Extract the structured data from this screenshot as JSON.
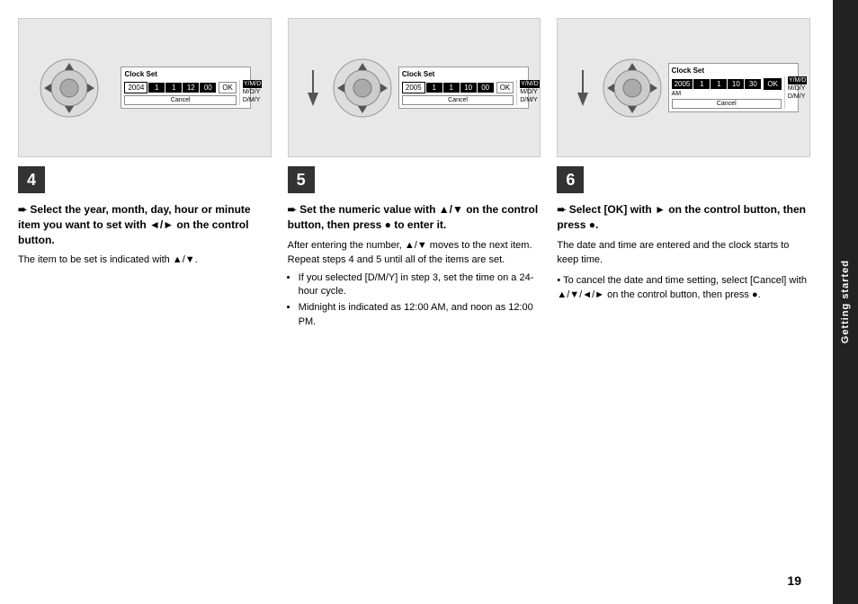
{
  "sidebar": {
    "label": "Getting started"
  },
  "page_number": "19",
  "steps": [
    {
      "number": "4",
      "heading": "Select the year, month, day, hour or minute item you want to set with ◄/► on the control button.",
      "body_text": "The item to be set is indicated with ▲/▼.",
      "clock_year": "2004",
      "clock_m1": "1",
      "clock_m2": "1",
      "clock_h": "12",
      "clock_min": "00",
      "clock_am": "",
      "active_field": "year"
    },
    {
      "number": "5",
      "heading": "Set the numeric value with ▲/▼ on the control button, then press ● to enter it.",
      "body_text": "After entering the number, ▲/▼ moves to the next item. Repeat steps 4 and 5 until all of the items are set.",
      "bullets": [
        "If you selected [D/M/Y] in step 3, set the time on a 24-hour cycle.",
        "Midnight is indicated as 12:00 AM, and noon as 12:00 PM."
      ],
      "clock_year": "2005",
      "clock_m1": "1",
      "clock_m2": "1",
      "clock_h": "10",
      "clock_min": "00",
      "clock_am": "",
      "active_field": "year"
    },
    {
      "number": "6",
      "heading": "Select [OK] with ► on the control button, then press ●.",
      "body_text": "The date and time are entered and the clock starts to keep time.",
      "bullet": "To cancel the date and time setting, select [Cancel] with ▲/▼/◄/► on the control button, then press ●.",
      "clock_year": "2005",
      "clock_m1": "1",
      "clock_m2": "1",
      "clock_h": "10",
      "clock_min": "30",
      "clock_am": "AM",
      "active_field": "ok"
    }
  ],
  "clock_ui": {
    "title": "Clock Set",
    "ok_label": "OK",
    "cancel_label": "Cancel",
    "options": [
      "Y/M/D",
      "M/D/Y",
      "D/M/Y"
    ]
  }
}
